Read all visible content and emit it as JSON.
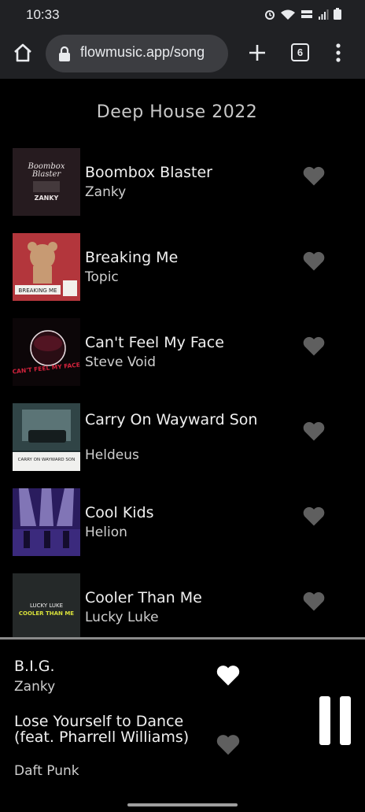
{
  "status_bar": {
    "time": "10:33",
    "icons": [
      "alarm-icon",
      "wifi-icon",
      "volte-lte-icon",
      "signal-icon",
      "battery-icon"
    ]
  },
  "browser": {
    "url": "flowmusic.app/song",
    "tab_count": "6",
    "icons": [
      "home-icon",
      "lock-icon",
      "plus-icon",
      "tabs-icon",
      "more-menu-icon"
    ]
  },
  "playlist": {
    "title": "Deep House 2022",
    "songs": [
      {
        "title": "Boombox Blaster",
        "artist": "Zanky",
        "liked": false
      },
      {
        "title": "Breaking Me",
        "artist": "Topic",
        "liked": false
      },
      {
        "title": "Can't Feel My Face",
        "artist": "Steve Void",
        "liked": false
      },
      {
        "title": "Carry On Wayward Son",
        "artist": "Heldeus",
        "liked": false
      },
      {
        "title": "Cool Kids",
        "artist": "Helion",
        "liked": false
      },
      {
        "title": "Cooler Than Me",
        "artist": "Lucky Luke",
        "liked": false
      }
    ],
    "cover_text": {
      "boombox": [
        "Boombox",
        "Blaster",
        "ZANKY"
      ],
      "breaking": [
        "BREAKING ME"
      ],
      "cant_feel": [
        "CAN'T FEEL MY FACE"
      ],
      "carry_on": [
        "CARRY ON WAYWARD SON"
      ],
      "cooler": [
        "LUCKY LUKE",
        "COOLER THAN ME"
      ]
    }
  },
  "player": {
    "queue": [
      {
        "title": "B.I.G.",
        "artist": "Zanky",
        "liked": true
      },
      {
        "title": "Lose Yourself to Dance (feat. Pharrell Williams)",
        "artist": "Daft Punk",
        "liked": false
      }
    ],
    "state": "playing"
  },
  "colors": {
    "heart_inactive": "#5f5f5f",
    "heart_active": "#ffffff",
    "browser_bar": "#202124",
    "background": "#000000"
  }
}
